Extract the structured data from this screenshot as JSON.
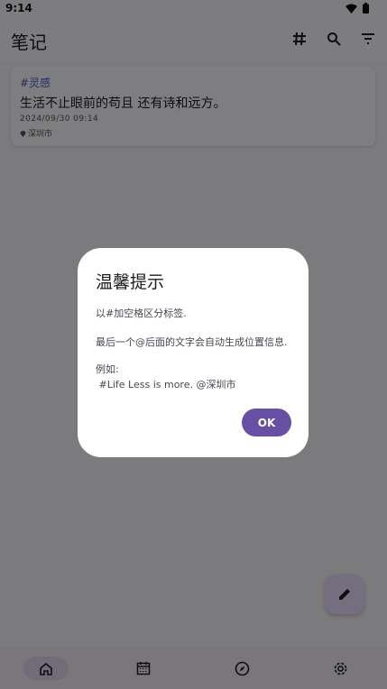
{
  "status_bar": {
    "time": "9:14"
  },
  "app_bar": {
    "title": "笔记"
  },
  "note": {
    "tag": "#灵感",
    "text": "生活不止眼前的苟且 还有诗和远方。",
    "datetime": "2024/09/30 09:14",
    "location": "深圳市"
  },
  "dialog": {
    "title": "温馨提示",
    "line1": "以#加空格区分标签.",
    "line2": "最后一个@后面的文字会自动生成位置信息.",
    "line3": "例如:",
    "line4": " #Life Less is more. @深圳市",
    "ok_label": "OK"
  },
  "colors": {
    "accent": "#6750a4",
    "tag_color": "#4b57c8",
    "fab_bg": "#eaddff",
    "scrim": "rgba(0,0,0,0.5)"
  },
  "icons": {
    "app_actions": [
      "hashtag-icon",
      "search-icon",
      "filter-icon"
    ],
    "bottom_nav": [
      "home-icon",
      "calendar-icon",
      "compass-icon",
      "settings-icon"
    ],
    "fab": "edit-icon"
  }
}
